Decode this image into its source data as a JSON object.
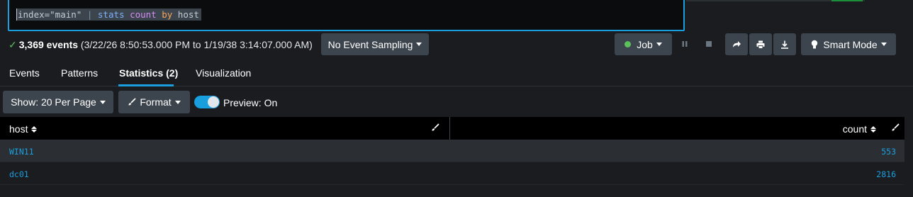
{
  "search": {
    "tokens": [
      {
        "text": "index=\"main\" ",
        "kind": "str"
      },
      {
        "text": "| ",
        "kind": "pipe"
      },
      {
        "text": "stats ",
        "kind": "cmd"
      },
      {
        "text": "count ",
        "kind": "fn"
      },
      {
        "text": "by ",
        "kind": "kw"
      },
      {
        "text": "host",
        "kind": "str"
      }
    ]
  },
  "status": {
    "count": "3,369 events",
    "range": " (3/22/26 8:50:53.000 PM to 1/19/38 3:14:07.000 AM)",
    "check_icon": "check-icon",
    "sampling_label": "No Event Sampling",
    "job_label": "Job",
    "mode_label": "Smart Mode"
  },
  "tabs": [
    {
      "label": "Events"
    },
    {
      "label": "Patterns"
    },
    {
      "label": "Statistics (2)",
      "active": true
    },
    {
      "label": "Visualization"
    }
  ],
  "toolbar": {
    "show_label": "Show: 20 Per Page",
    "format_label": "Format",
    "preview_label": "Preview: On",
    "preview_on": true
  },
  "table": {
    "columns": [
      "host",
      "count"
    ],
    "rows": [
      {
        "host": "WIN11",
        "count": "553"
      },
      {
        "host": "dc01",
        "count": "2816"
      }
    ]
  },
  "colors": {
    "accent": "#1a9fde",
    "success": "#5cc05c",
    "button": "#3c444d"
  }
}
